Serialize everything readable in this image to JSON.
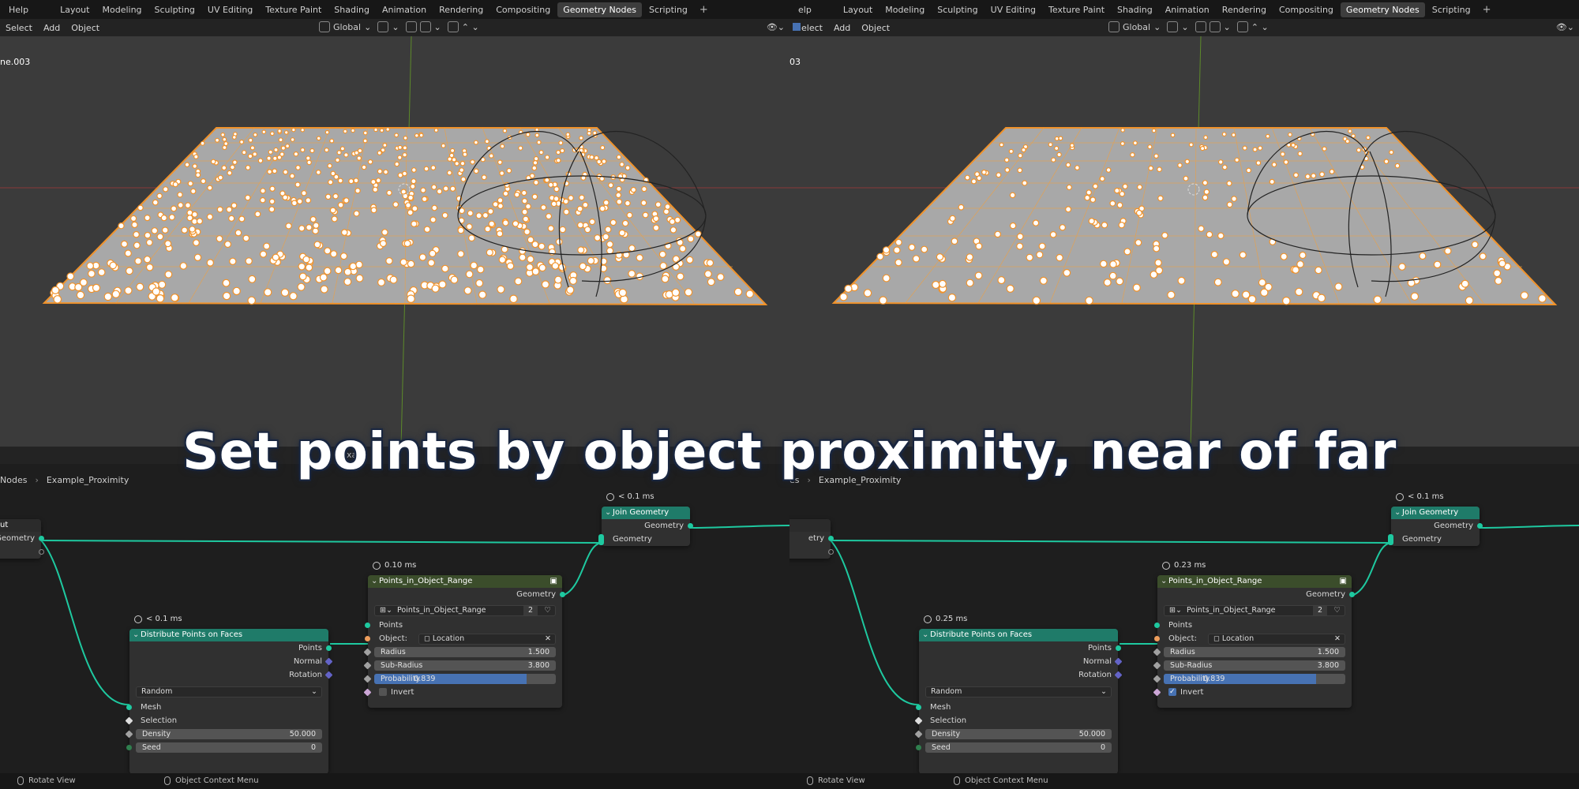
{
  "menu": {
    "help": "Help",
    "help_cut": "elp"
  },
  "workspaces": [
    "Layout",
    "Modeling",
    "Sculpting",
    "UV Editing",
    "Texture Paint",
    "Shading",
    "Animation",
    "Rendering",
    "Compositing",
    "Geometry Nodes",
    "Scripting"
  ],
  "active_workspace": "Geometry Nodes",
  "viewport_menu": {
    "select": "Select",
    "select_cut": "elect",
    "add": "Add",
    "object": "Object",
    "orientation": "Global"
  },
  "viewports": [
    {
      "object_name": "ne.003",
      "proximity": "near",
      "point_count_density": "high"
    },
    {
      "object_name": "03",
      "proximity": "far",
      "point_count_density": "low"
    }
  ],
  "breadcrumb": {
    "root": "Nodes",
    "root_cut": "es",
    "tree": "Example_Proximity"
  },
  "header_texts": {
    "left_field": "Exam",
    "right_field": "Exa"
  },
  "nodes": {
    "group_input": {
      "title": "ut",
      "socket": "Geometry",
      "socket_cut": "etry"
    },
    "join_geometry": {
      "title": "Join Geometry",
      "input": "Geometry",
      "output": "Geometry",
      "timing": "< 0.1 ms"
    },
    "distribute": {
      "title": "Distribute Points on Faces",
      "outputs": {
        "points": "Points",
        "normal": "Normal",
        "rotation": "Rotation"
      },
      "mode": "Random",
      "inputs": {
        "mesh": "Mesh",
        "selection": "Selection",
        "density_label": "Density",
        "density": "50.000",
        "seed_label": "Seed",
        "seed": "0"
      }
    },
    "points_in_range": {
      "title": "Points_in_Object_Range",
      "group_name": "Points_in_Object_Range",
      "users": "2",
      "output": "Geometry",
      "points": "Points",
      "object_label": "Object:",
      "object_value": "Location",
      "radius_label": "Radius",
      "radius": "1.500",
      "subradius_label": "Sub-Radius",
      "subradius": "3.800",
      "probability_label": "Probability",
      "probability": "0.839",
      "probability_fraction": 0.839,
      "invert_label": "Invert"
    }
  },
  "panels": [
    {
      "distribute_timing": "< 0.1 ms",
      "range_timing": "0.10 ms",
      "invert": false
    },
    {
      "distribute_timing": "0.25 ms",
      "range_timing": "0.23 ms",
      "invert": true
    }
  ],
  "statusbar": {
    "rotate": "Rotate View",
    "context": "Object Context Menu"
  },
  "banner": "Set points by object proximity, near of far",
  "colors": {
    "accent": "#4772b3",
    "geometry_socket": "#1ec9a0",
    "selection_orange": "#f0922a",
    "node_header_teal": "#1f7b69"
  }
}
